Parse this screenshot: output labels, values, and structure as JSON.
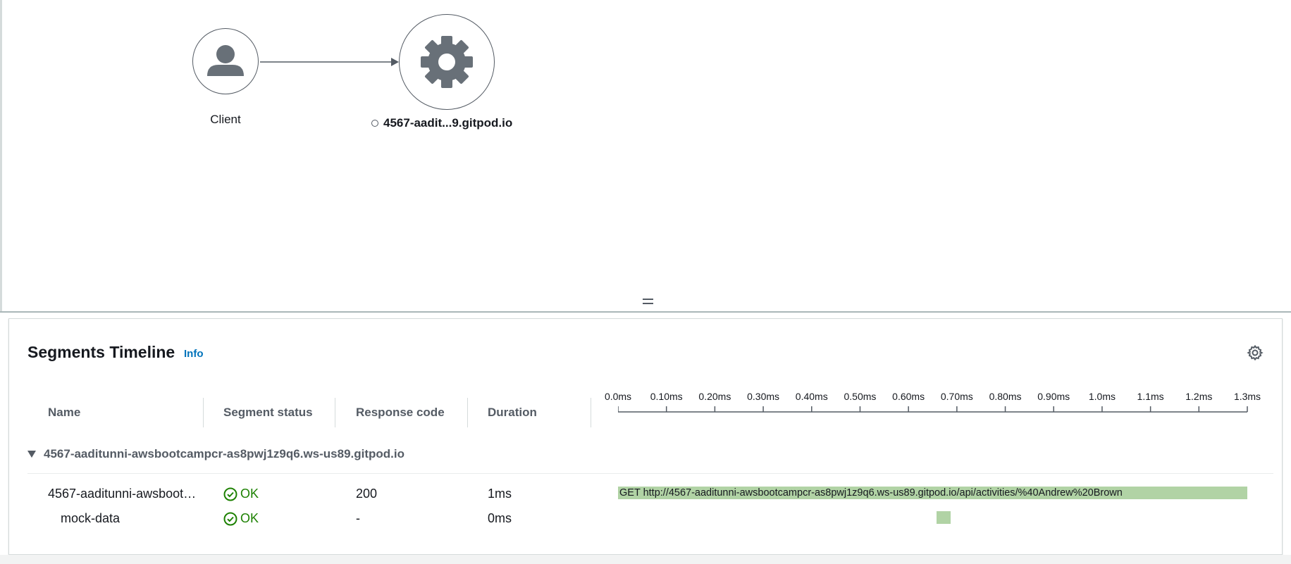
{
  "service_map": {
    "client_label": "Client",
    "service_label": "4567-aadit...9.gitpod.io"
  },
  "panel": {
    "title": "Segments Timeline",
    "info_link": "Info"
  },
  "table": {
    "columns": {
      "name": "Name",
      "status": "Segment status",
      "response": "Response code",
      "duration": "Duration"
    },
    "axis_ticks": [
      "0.0ms",
      "0.10ms",
      "0.20ms",
      "0.30ms",
      "0.40ms",
      "0.50ms",
      "0.60ms",
      "0.70ms",
      "0.80ms",
      "0.90ms",
      "1.0ms",
      "1.1ms",
      "1.2ms",
      "1.3ms"
    ],
    "group": {
      "label": "4567-aaditunni-awsbootcampcr-as8pwj1z9q6.ws-us89.gitpod.io"
    },
    "rows": [
      {
        "name": "4567-aaditunni-awsboot…",
        "status": "OK",
        "response": "200",
        "duration": "1ms",
        "bar_label": "GET http://4567-aaditunni-awsbootcampcr-as8pwj1z9q6.ws-us89.gitpod.io/api/activities/%40Andrew%20Brown"
      },
      {
        "name": "mock-data",
        "status": "OK",
        "response": "-",
        "duration": "0ms",
        "bar_label": ""
      }
    ]
  },
  "colors": {
    "ok": "#1d8102",
    "bar": "#b1d3a5",
    "link": "#0073bb"
  }
}
